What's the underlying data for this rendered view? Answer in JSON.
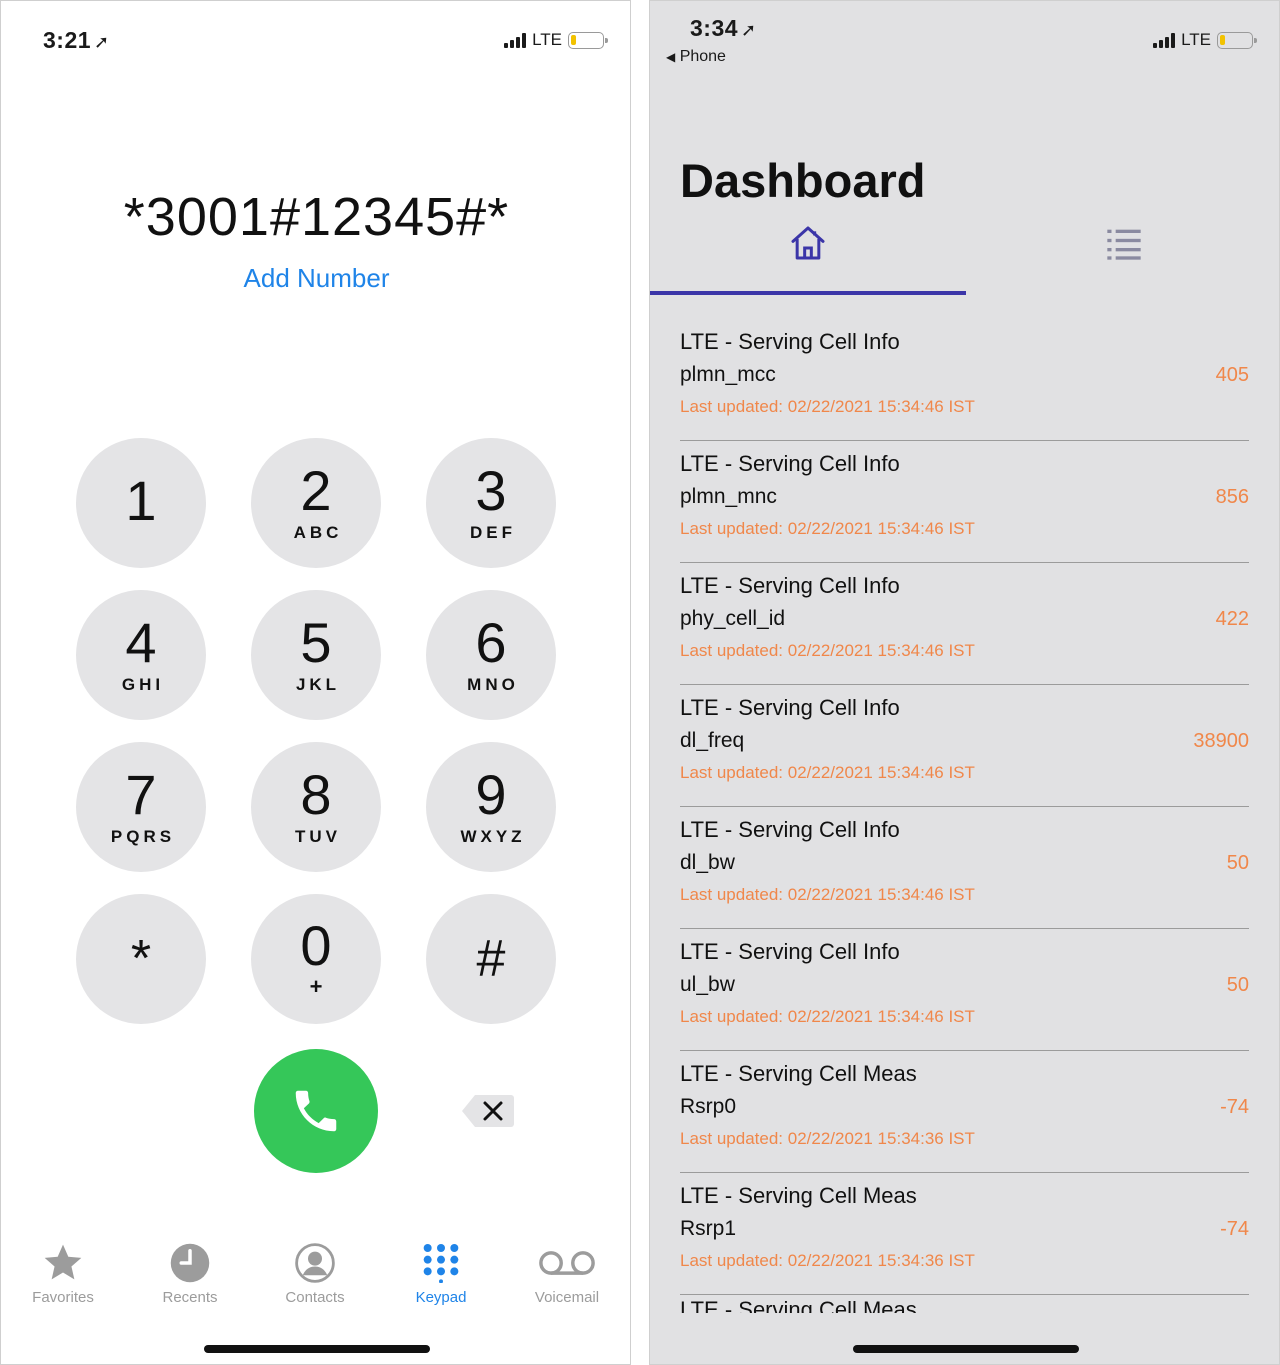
{
  "dialer": {
    "status": {
      "time": "3:21",
      "network": "LTE"
    },
    "dialed_number": "*3001#12345#*",
    "add_number_label": "Add Number",
    "keys": [
      {
        "num": "1",
        "letters": ""
      },
      {
        "num": "2",
        "letters": "ABC"
      },
      {
        "num": "3",
        "letters": "DEF"
      },
      {
        "num": "4",
        "letters": "GHI"
      },
      {
        "num": "5",
        "letters": "JKL"
      },
      {
        "num": "6",
        "letters": "MNO"
      },
      {
        "num": "7",
        "letters": "PQRS"
      },
      {
        "num": "8",
        "letters": "TUV"
      },
      {
        "num": "9",
        "letters": "WXYZ"
      },
      {
        "num": "*",
        "letters": ""
      },
      {
        "num": "0",
        "letters": "+"
      },
      {
        "num": "#",
        "letters": ""
      }
    ],
    "tabs": [
      {
        "label": "Favorites",
        "icon": "star-icon",
        "active": false
      },
      {
        "label": "Recents",
        "icon": "clock-icon",
        "active": false
      },
      {
        "label": "Contacts",
        "icon": "person-circle-icon",
        "active": false
      },
      {
        "label": "Keypad",
        "icon": "keypad-icon",
        "active": true
      },
      {
        "label": "Voicemail",
        "icon": "voicemail-icon",
        "active": false
      }
    ],
    "colors": {
      "accent": "#1f84e8",
      "call": "#35c759",
      "key_bg": "#e4e4e6"
    }
  },
  "dashboard": {
    "status": {
      "time": "3:34",
      "network": "LTE",
      "back_label": "Phone"
    },
    "title": "Dashboard",
    "tabs": [
      {
        "name": "home",
        "icon": "home-icon",
        "active": true
      },
      {
        "name": "list",
        "icon": "list-icon",
        "active": false
      }
    ],
    "rows": [
      {
        "title": "LTE - Serving Cell Info",
        "key": "plmn_mcc",
        "value": "405",
        "updated": "Last updated: 02/22/2021 15:34:46 IST"
      },
      {
        "title": "LTE - Serving Cell Info",
        "key": "plmn_mnc",
        "value": "856",
        "updated": "Last updated: 02/22/2021 15:34:46 IST"
      },
      {
        "title": "LTE - Serving Cell Info",
        "key": "phy_cell_id",
        "value": "422",
        "updated": "Last updated: 02/22/2021 15:34:46 IST"
      },
      {
        "title": "LTE - Serving Cell Info",
        "key": "dl_freq",
        "value": "38900",
        "updated": "Last updated: 02/22/2021 15:34:46 IST"
      },
      {
        "title": "LTE - Serving Cell Info",
        "key": "dl_bw",
        "value": "50",
        "updated": "Last updated: 02/22/2021 15:34:46 IST"
      },
      {
        "title": "LTE - Serving Cell Info",
        "key": "ul_bw",
        "value": "50",
        "updated": "Last updated: 02/22/2021 15:34:46 IST"
      },
      {
        "title": "LTE - Serving Cell Meas",
        "key": "Rsrp0",
        "value": "-74",
        "updated": "Last updated: 02/22/2021 15:34:36 IST"
      },
      {
        "title": "LTE - Serving Cell Meas",
        "key": "Rsrp1",
        "value": "-74",
        "updated": "Last updated: 02/22/2021 15:34:36 IST"
      }
    ],
    "partial_row_title": "LTE - Serving Cell Meas",
    "colors": {
      "accent": "#3b35a8",
      "value": "#f0874a"
    }
  }
}
